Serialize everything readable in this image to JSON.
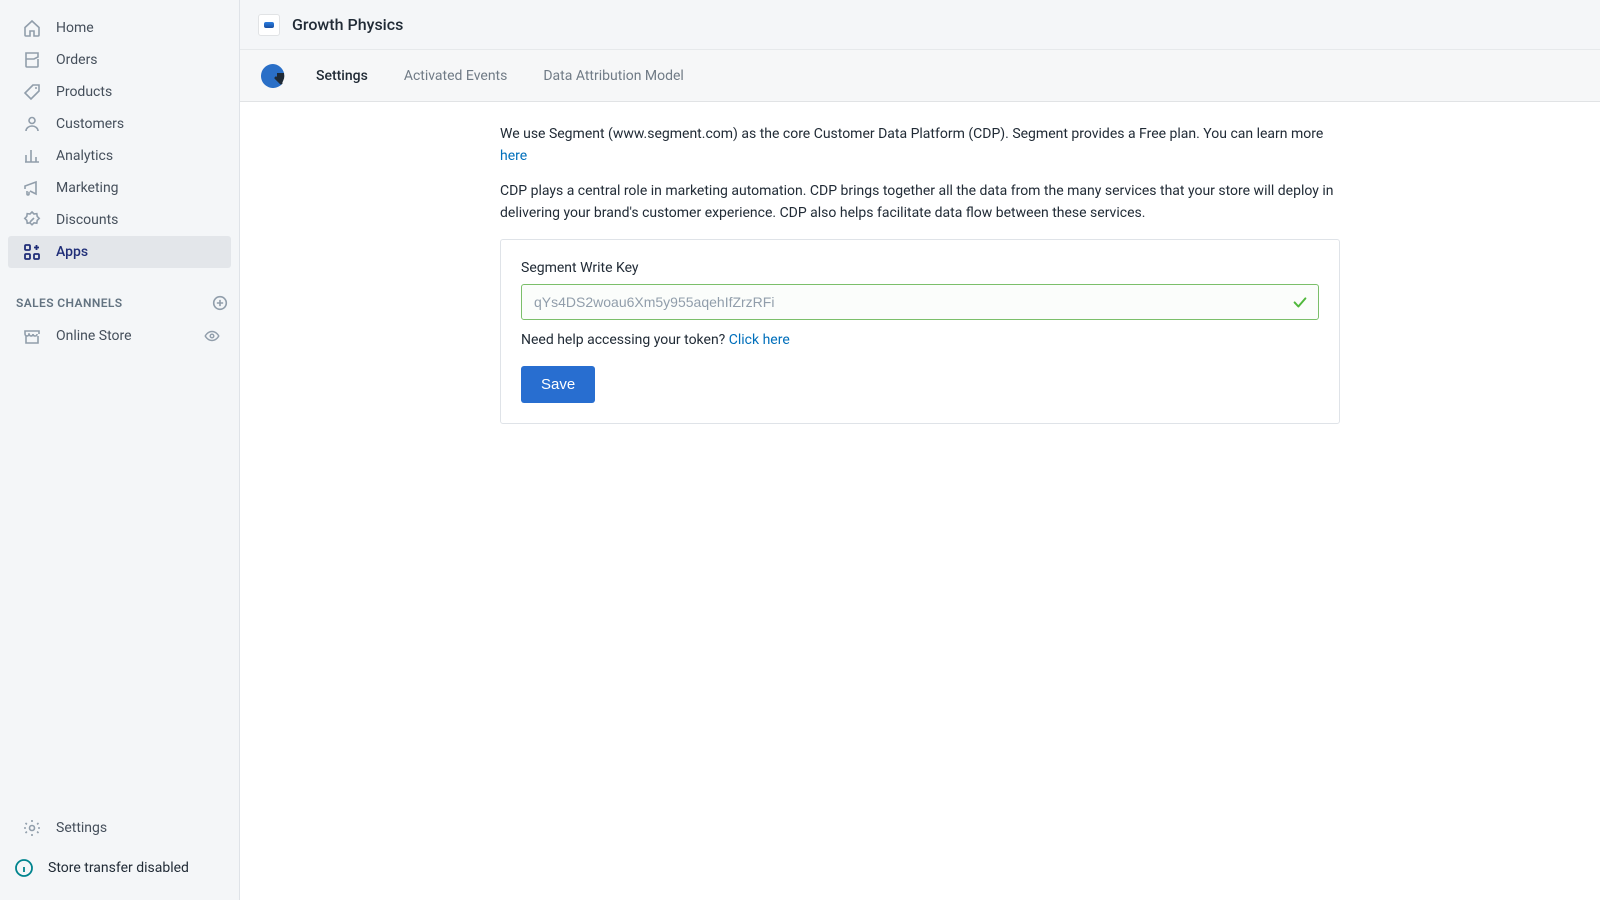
{
  "sidebar": {
    "items": [
      {
        "id": "home",
        "label": "Home"
      },
      {
        "id": "orders",
        "label": "Orders"
      },
      {
        "id": "products",
        "label": "Products"
      },
      {
        "id": "customers",
        "label": "Customers"
      },
      {
        "id": "analytics",
        "label": "Analytics"
      },
      {
        "id": "marketing",
        "label": "Marketing"
      },
      {
        "id": "discounts",
        "label": "Discounts"
      },
      {
        "id": "apps",
        "label": "Apps"
      }
    ],
    "active_id": "apps",
    "channels_heading": "SALES CHANNELS",
    "channels": [
      {
        "id": "online-store",
        "label": "Online Store"
      }
    ],
    "bottom": {
      "settings_label": "Settings",
      "transfer_label": "Store transfer disabled"
    }
  },
  "header": {
    "app_title": "Growth Physics",
    "tabs": [
      {
        "id": "settings",
        "label": "Settings"
      },
      {
        "id": "activated-events",
        "label": "Activated Events"
      },
      {
        "id": "data-attribution",
        "label": "Data Attribution Model"
      }
    ],
    "active_tab_id": "settings"
  },
  "content": {
    "intro1_prefix": "We use Segment (www.segment.com) as the core Customer Data Platform (CDP). Segment provides a Free plan. You can learn more ",
    "intro1_link": "here",
    "intro2": "CDP plays a central role in marketing automation. CDP brings together all the data from the many services that your store will deploy in delivering your brand's customer experience. CDP also helps facilitate data flow between these services.",
    "form": {
      "field_label": "Segment Write Key",
      "placeholder": "qYs4DS2woau6Xm5y955aqehIfZrzRFi",
      "value": "",
      "help_prefix": "Need help accessing your token? ",
      "help_link": "Click here",
      "save_label": "Save"
    }
  }
}
